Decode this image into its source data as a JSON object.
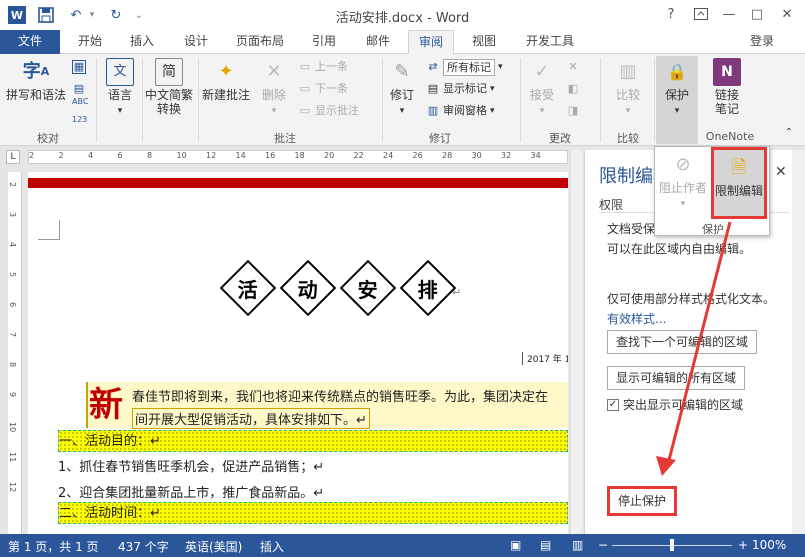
{
  "title": "活动安排.docx - Word",
  "signin": "登录",
  "help": "?",
  "tabs": [
    "文件",
    "开始",
    "插入",
    "设计",
    "页面布局",
    "引用",
    "邮件",
    "审阅",
    "视图",
    "开发工具"
  ],
  "ribbon": {
    "spell": "拼写和语法",
    "proof_group": "校对",
    "language": "语言",
    "chinese": "中文简繁转换",
    "new_comment": "新建批注",
    "delete": "删除",
    "prev": "上一条",
    "next": "下一条",
    "show_comments": "显示批注",
    "comments_group": "批注",
    "track": "修订",
    "all_markup": "所有标记",
    "show_markup": "显示标记",
    "review_pane": "审阅窗格",
    "track_group": "修订",
    "accept": "接受",
    "changes_group": "更改",
    "compare": "比较",
    "compare_group": "比较",
    "protect": "保护",
    "linked_notes": "链接笔记",
    "onenote_group": "OneNote"
  },
  "popup": {
    "block_authors": "阻止作者",
    "restrict_editing": "限制编辑",
    "group": "保护"
  },
  "pane": {
    "title": "限制编辑",
    "sub": "权限",
    "text1": "文档受保",
    "text2": "可以在此区域内自由编辑。",
    "text3": "仅可使用部分样式格式化文本。",
    "link": "有效样式...",
    "find_next": "查找下一个可编辑的区域",
    "show_all": "显示可编辑的所有区域",
    "highlight": "突出显示可编辑的区域",
    "stop": "停止保护"
  },
  "ruler": {
    "marks": [
      "2",
      "2",
      "4",
      "6",
      "8",
      "10",
      "12",
      "14",
      "16",
      "18",
      "20",
      "22",
      "24",
      "26",
      "28",
      "30",
      "32",
      "34"
    ],
    "vmarks": [
      "2",
      "3",
      "4",
      "5",
      "6",
      "7",
      "8",
      "9",
      "10",
      "11",
      "12"
    ]
  },
  "doc": {
    "heading": [
      "活",
      "动",
      "安",
      "排"
    ],
    "date": "2017 年 1",
    "big": "新",
    "para1": "春佳节即将到来，我们也将迎来传统糕点的销售旺季。为此，集团决定在",
    "para2": "间开展大型促销活动，具体安排如下。↵",
    "s1": "一、活动目的：↵",
    "l1": "1、抓住春节销售旺季机会，促进产品销售；↵",
    "l2": "2、迎合集团批量新品上市，推广食品新品。↵",
    "s2": "二、活动时间：↵"
  },
  "status": {
    "page": "第 1 页，共 1 页",
    "words": "437 个字",
    "lang": "英语(美国)",
    "mode": "插入",
    "zoom": "100%"
  }
}
